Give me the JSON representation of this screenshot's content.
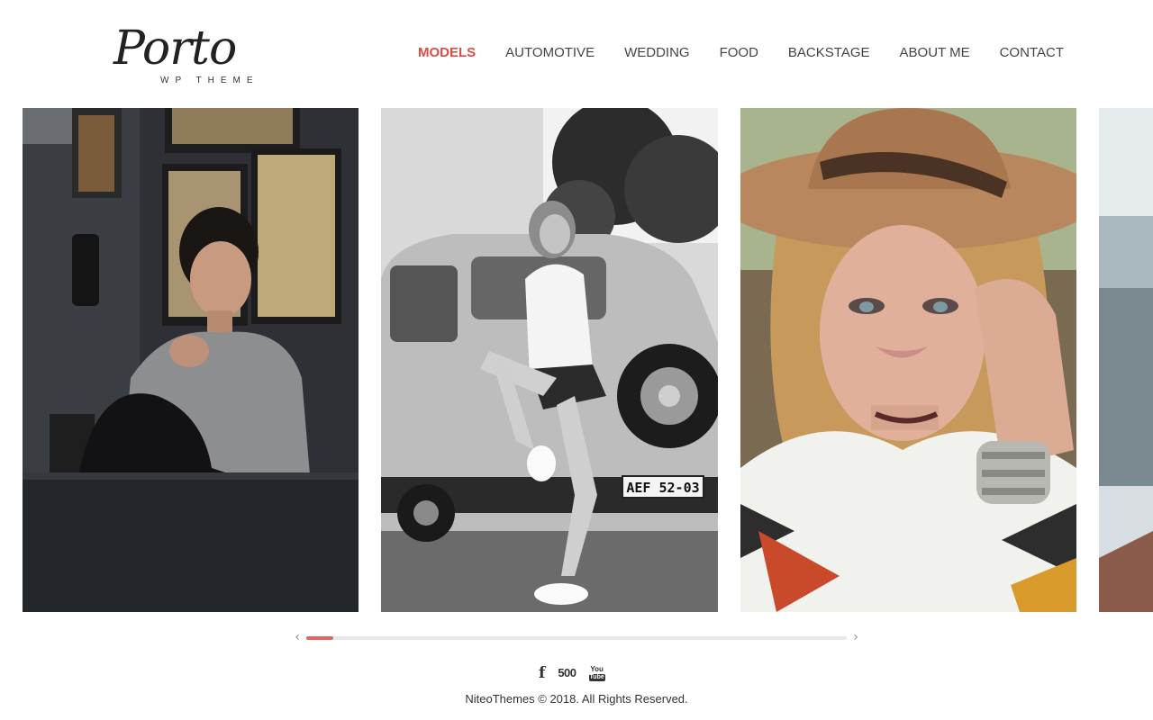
{
  "logo": {
    "wordmark": "Porto",
    "tagline": "WP THEME"
  },
  "nav": {
    "items": [
      {
        "label": "MODELS",
        "active": true
      },
      {
        "label": "AUTOMOTIVE",
        "active": false
      },
      {
        "label": "WEDDING",
        "active": false
      },
      {
        "label": "FOOD",
        "active": false
      },
      {
        "label": "BACKSTAGE",
        "active": false
      },
      {
        "label": "ABOUT ME",
        "active": false
      },
      {
        "label": "CONTACT",
        "active": false
      }
    ]
  },
  "colors": {
    "accent": "#e04b45",
    "scroll_thumb": "#e0665f",
    "text": "#333333"
  },
  "gallery": {
    "slides": [
      {
        "icon": "photo-woman-sitting-cafe"
      },
      {
        "icon": "photo-woman-vintage-van"
      },
      {
        "icon": "photo-woman-felt-hat"
      },
      {
        "icon": "photo-partial-window"
      }
    ],
    "license_plate": "AEF 52-03",
    "scroll_progress": 0.05
  },
  "scrollbar": {
    "left_icon": "chevron-left-icon",
    "right_icon": "chevron-right-icon"
  },
  "social": {
    "facebook": "f",
    "px500": "500",
    "youtube_top": "You",
    "youtube_bottom": "Tube"
  },
  "footer": {
    "copyright": "NiteoThemes © 2018. All Rights Reserved."
  }
}
